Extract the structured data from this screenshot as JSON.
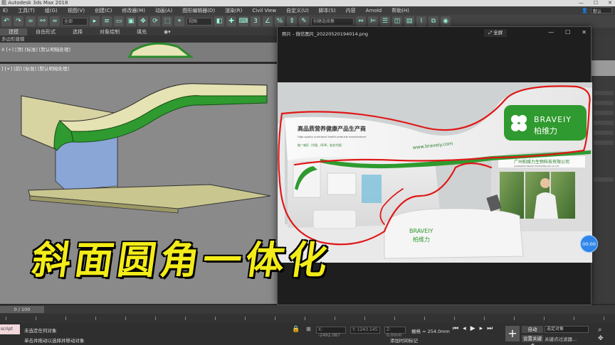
{
  "app": {
    "title": "Autodesk 3ds Max 2018",
    "title_prefix": "题",
    "window_buttons": [
      "—",
      "☐",
      "✕"
    ]
  },
  "menu": [
    "E)",
    "工具(T)",
    "组(G)",
    "视图(V)",
    "创建(C)",
    "修改器(M)",
    "动画(A)",
    "图形编辑器(D)",
    "渲染(R)",
    "Civil View",
    "自定义(U)",
    "脚本(S)",
    "内容",
    "Arnold",
    "帮助(H)"
  ],
  "menu_right": {
    "workspace": "默认",
    "user_icon": "user-icon"
  },
  "toolbar": {
    "filter_all": "全部",
    "view_drop": "视图",
    "selset_drop": "创建选择集"
  },
  "ribbon": {
    "tabs": [
      "建模",
      "自由形式",
      "选择",
      "对象绘制",
      "填充"
    ],
    "active_index": 0,
    "sub": "多边形建模"
  },
  "viewports": {
    "top_label": "[+] [顶] [标准] [默认明暗处理]",
    "main_label": "[+] [前] [标准] [默认明暗处理]",
    "left_marker_top": "X",
    "left_marker_main": "]"
  },
  "viewer": {
    "title": "照片 - 微信图片_20220520194014.png",
    "fullscreen_label": "全屏",
    "buttons": [
      "—",
      "☐",
      "✕"
    ],
    "photo": {
      "headline_cn": "高品质营养健康产品生产商",
      "headline_en": "High-quality nutritional health products manufacturer",
      "service": "推广威旺（代理，OEM，批发代理）",
      "website": "www.braveiy.com",
      "brand_en": "BRAVEIY",
      "brand_cn": "柏维力",
      "company": "广州柏维力生物科技有限公司",
      "company_en": "GUANGZHOU BRAVEIY BIOTECHNOLOGY CO.,LTD.",
      "counter_brand_en": "BRAVEIY",
      "counter_brand_cn": "柏维力"
    }
  },
  "timer": "00:00",
  "caption": "斜面圆角一体化",
  "timeline": {
    "frame": "0 / 100"
  },
  "status": {
    "maxscript": "script",
    "line1": "未选定任何对象",
    "line2": "单击并拖动以选择并移动对象",
    "x": "X: -2492.087",
    "y": "Y: 1243.145",
    "z": "Z: 0.0mm",
    "grid": "栅格 = 254.0mm",
    "add_time_tag": "添加时间标记",
    "auto": "自动",
    "selected": "选定对象",
    "set_key": "设置关键点",
    "key_filter": "关键点过滤器..."
  },
  "colors": {
    "annotation_red": "#e01818",
    "brand_green": "#2f9a2f",
    "caption_yellow": "#f3ec18",
    "timer_blue": "#2f86e8"
  }
}
